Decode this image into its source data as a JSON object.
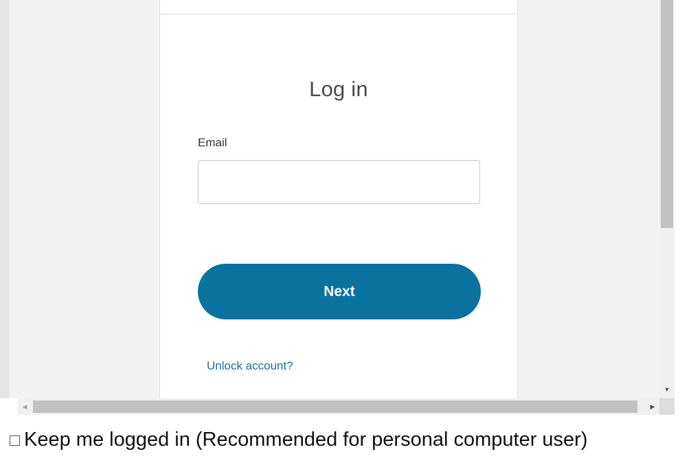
{
  "login": {
    "title": "Log in",
    "email_label": "Email",
    "email_value": "",
    "email_placeholder": "",
    "next_label": "Next",
    "unlock_label": "Unlock account?"
  },
  "keep_logged_in": {
    "checked": false,
    "label": "Keep me logged in (Recommended for personal computer user)"
  },
  "colors": {
    "accent": "#0a729e",
    "link": "#1a6e98",
    "page_background": "#f2f2f2"
  },
  "icons": {
    "scroll_down": "caret-down-icon",
    "scroll_left": "caret-left-icon",
    "scroll_right": "caret-right-icon"
  }
}
